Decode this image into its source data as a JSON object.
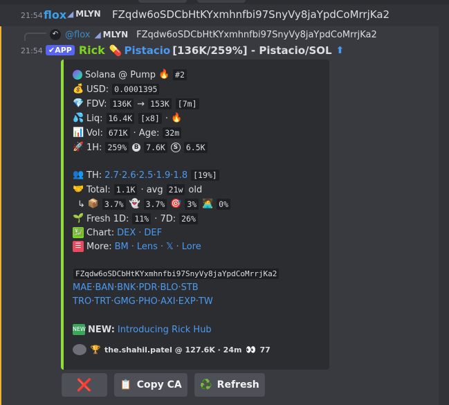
{
  "top_message": {
    "time": "21:54",
    "user": "flox",
    "tag": "MLYN",
    "text": "FZqdw6oSDCbHtKYxmhnfbi97SnyVy8jaYpdCoMrrjKa2"
  },
  "reply_ref": {
    "user": "@flox",
    "tag": "MLYN",
    "text": "FZqdw6oSDCbHtKYxmhnfbi97SnyVy8jaYpdCoMrrjKa2"
  },
  "bot_message": {
    "time": "21:54",
    "app_badge": "APP",
    "user": "Rick",
    "pill": "💊",
    "title_link": "Pistacio",
    "title_rest": "[136K/259%] - Pistacio/SOL",
    "arrow": "⬆"
  },
  "embed": {
    "header": {
      "text": "Solana @ Pump",
      "fire": "🔥",
      "rank": "#2"
    },
    "usd": {
      "label": "USD:",
      "value": "0.0001395"
    },
    "fdv": {
      "label": "FDV:",
      "from": "136K",
      "arrow": "→",
      "to": "153K",
      "span": "[7m]"
    },
    "liq": {
      "label": "Liq:",
      "value": "16.4K",
      "mult": "[x8]",
      "sep": "·"
    },
    "vol": {
      "label": "Vol:",
      "value": "671K",
      "age_label": "· Age:",
      "age": "32m"
    },
    "h1": {
      "label": "1H:",
      "pct": "259%",
      "buy": "7.6K",
      "sell": "6.5K"
    },
    "th": {
      "label": "TH:",
      "values": [
        "2.7",
        "2.6",
        "2.5",
        "1.9",
        "1.8"
      ],
      "total": "[19%]"
    },
    "total": {
      "label": "Total:",
      "value": "1.1K",
      "avg_label": "· avg",
      "avg": "21w",
      "suffix": "old"
    },
    "dist": {
      "arrow": "↳",
      "a": "3.7%",
      "b": "3.7%",
      "c": "3%",
      "d": "0%"
    },
    "fresh": {
      "label": "Fresh 1D:",
      "d1": "11%",
      "d7_label": "· 7D:",
      "d7": "26%"
    },
    "chart": {
      "label": "Chart:",
      "links": [
        "DEX",
        "DEF"
      ]
    },
    "more": {
      "label": "More:",
      "links": [
        "BM",
        "Lens",
        "𝕏",
        "Lore"
      ]
    },
    "ca": "FZqdw6oSDCbHtKYxmhnfbi97SnyVy8jaYpdCoMrrjKa2",
    "links_row1": [
      "MAE",
      "BAN",
      "BNK",
      "PDR",
      "BLO",
      "STB"
    ],
    "links_row2": [
      "TRO",
      "TRT",
      "GMG",
      "PHO",
      "AXI",
      "EXP",
      "TW"
    ],
    "news": {
      "label": "NEW:",
      "link": "Introducing Rick Hub"
    },
    "footer": {
      "text": "the.shahil.patel @ 127.6K · 24m",
      "count": "77"
    }
  },
  "buttons": {
    "close": "❌",
    "copy_label": "Copy CA",
    "copy_icon": "📋",
    "refresh_label": "Refresh",
    "refresh_icon": "♻️"
  },
  "colors": {
    "accent_bar": "#8fdc3a",
    "link": "#4c9af0",
    "rick": "#7ed321",
    "app_badge": "#5865f2"
  }
}
